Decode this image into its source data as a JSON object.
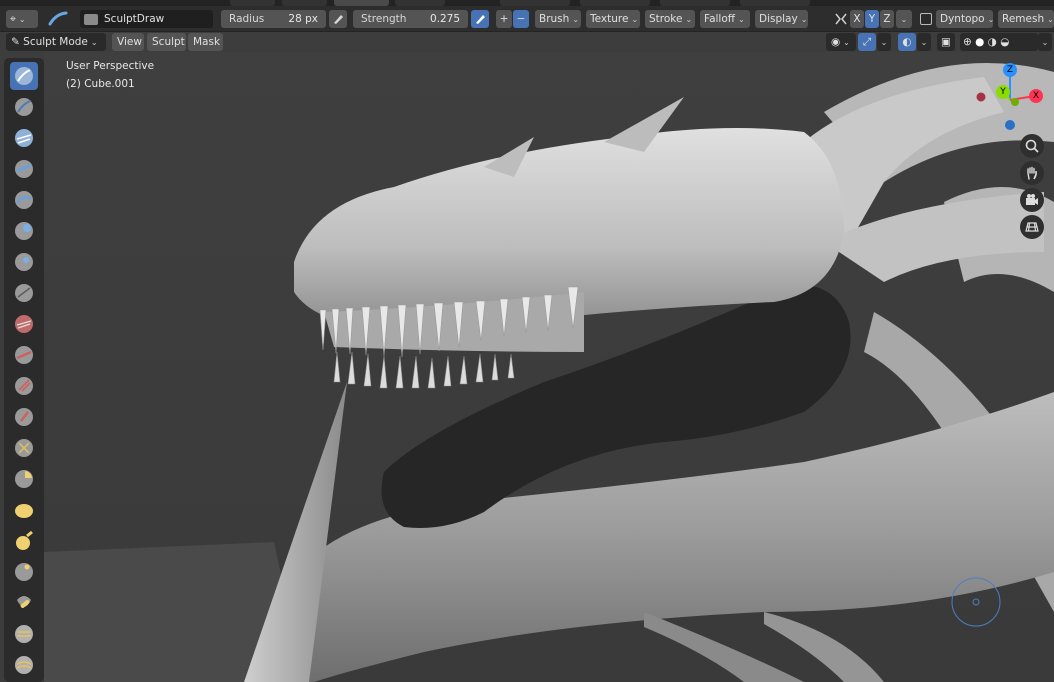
{
  "header": {
    "brush_name": "SculptDraw",
    "radius_label": "Radius",
    "radius_value": "28 px",
    "strength_label": "Strength",
    "strength_value": "0.275",
    "plus": "+",
    "minus": "−",
    "menus": [
      "Brush",
      "Texture",
      "Stroke",
      "Falloff",
      "Display"
    ],
    "axis_x": "X",
    "axis_y": "Y",
    "axis_z": "Z",
    "dyntopo_label": "Dyntopo",
    "remesh_label": "Remesh"
  },
  "modebar": {
    "mode_label": "Sculpt Mode",
    "view_label": "View",
    "sculpt_label": "Sculpt",
    "mask_label": "Mask"
  },
  "viewport": {
    "perspective_label": "User Perspective",
    "object_label": "(2) Cube.001"
  },
  "gizmo": {
    "x_label": "X",
    "y_label": "Y",
    "z_label": "Z"
  },
  "colors": {
    "accent": "#4772b3",
    "header_bg": "#2d2d2d",
    "button_bg": "#545454",
    "viewport_bg": "#3d3d3d",
    "axis_x": "#ff3352",
    "axis_y": "#8bdc00",
    "axis_z": "#2890ff"
  },
  "toolbar_icons": [
    "draw-brush-icon",
    "draw-sharp-icon",
    "clay-icon",
    "clay-strips-icon",
    "layer-icon",
    "inflate-icon",
    "blob-icon",
    "crease-icon",
    "smooth-icon",
    "flatten-icon",
    "fill-icon",
    "scrape-icon",
    "pinch-icon",
    "grab-icon",
    "snake-hook-icon",
    "thumb-icon",
    "nudge-icon",
    "rotate-icon",
    "simplify-icon",
    "mask-icon",
    "box-mask-icon"
  ]
}
